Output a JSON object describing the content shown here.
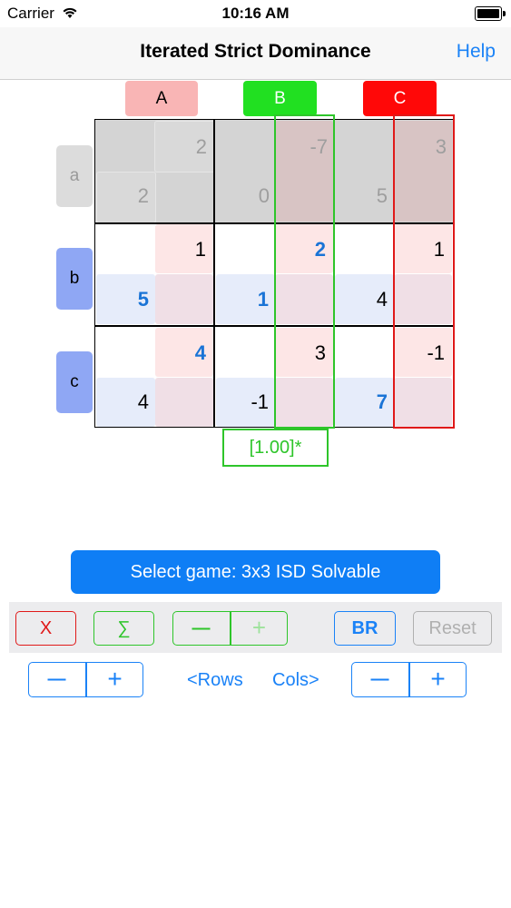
{
  "status": {
    "carrier": "Carrier",
    "time": "10:16 AM"
  },
  "nav": {
    "title": "Iterated Strict Dominance",
    "help": "Help"
  },
  "columns": [
    {
      "label": "A",
      "color": "#f9b5b5"
    },
    {
      "label": "B",
      "color": "#2de02a"
    },
    {
      "label": "C",
      "color": "#ff0000"
    }
  ],
  "rows": [
    {
      "label": "a",
      "color": "#dddddd"
    },
    {
      "label": "b",
      "color": "#8fa8f5"
    },
    {
      "label": "c",
      "color": "#8fa8f5"
    }
  ],
  "payoffs": {
    "a": {
      "A": {
        "col": "2",
        "row": "2"
      },
      "B": {
        "col": "-7",
        "row": "0"
      },
      "C": {
        "col": "3",
        "row": "5"
      }
    },
    "b": {
      "A": {
        "col": "1",
        "row": "5"
      },
      "B": {
        "col": "2",
        "row": "1"
      },
      "C": {
        "col": "1",
        "row": "4"
      }
    },
    "c": {
      "A": {
        "col": "4",
        "row": "4"
      },
      "B": {
        "col": "3",
        "row": "-1"
      },
      "C": {
        "col": "-1",
        "row": "7"
      }
    }
  },
  "probability_label": "[1.00]*",
  "select_game": "Select game: 3x3 ISD Solvable",
  "controls": {
    "x": "X",
    "sum": "∑",
    "minus": "—",
    "plus": "+",
    "br": "BR",
    "reset": "Reset"
  },
  "size_controls": {
    "rows_minus": "—",
    "rows_plus": "+",
    "rows_label": "<Rows",
    "cols_label": "Cols>",
    "cols_minus": "—",
    "cols_plus": "+"
  },
  "colors": {
    "accent_blue": "#1a82f7",
    "green": "#2ec52a",
    "red": "#e01919",
    "highlight_blue": "#1a74d6"
  }
}
